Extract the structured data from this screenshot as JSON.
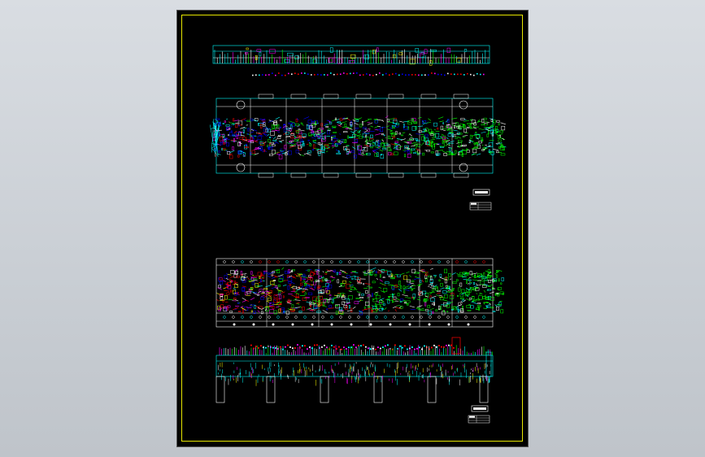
{
  "viewer": {
    "sheet_border_color": "#e6e600",
    "background": "#000000"
  },
  "palette": {
    "cyan": "#00ffff",
    "green": "#00ff00",
    "white": "#ffffff",
    "magenta": "#ff00ff",
    "red": "#ff0000",
    "blue": "#0000ff",
    "yellow": "#ffff00"
  },
  "views": [
    {
      "id": "top-strip-view",
      "kind": "strip"
    },
    {
      "id": "plan-view-upper",
      "kind": "plan"
    },
    {
      "id": "plan-view-lower",
      "kind": "plan"
    },
    {
      "id": "elevation-view",
      "kind": "elevation"
    }
  ],
  "title_blocks": [
    {
      "id": "title-block-upper"
    },
    {
      "id": "title-block-lower"
    }
  ]
}
